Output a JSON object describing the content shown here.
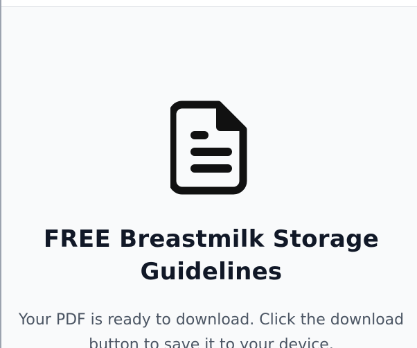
{
  "icon": "pdf-document-icon",
  "colors": {
    "background": "#f9fafb",
    "title": "#111827",
    "text": "#4b5563",
    "icon": "#111111"
  },
  "title": "FREE Breastmilk Storage Guidelines",
  "message": "Your PDF is ready to download. Click the download button to save it to your device."
}
